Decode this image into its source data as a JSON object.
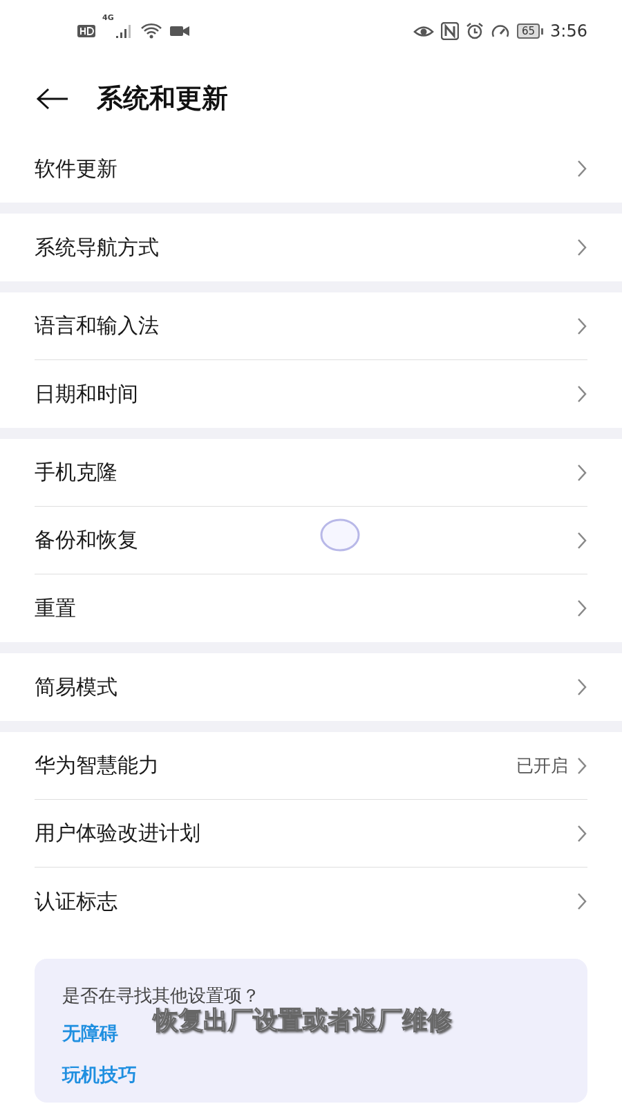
{
  "status_bar": {
    "network": "4G",
    "battery": "65",
    "time": "3:56"
  },
  "header": {
    "title": "系统和更新"
  },
  "groups": [
    {
      "rows": [
        {
          "label": "软件更新"
        }
      ]
    },
    {
      "rows": [
        {
          "label": "系统导航方式"
        }
      ]
    },
    {
      "rows": [
        {
          "label": "语言和输入法"
        },
        {
          "label": "日期和时间"
        }
      ]
    },
    {
      "rows": [
        {
          "label": "手机克隆"
        },
        {
          "label": "备份和恢复"
        },
        {
          "label": "重置"
        }
      ]
    },
    {
      "rows": [
        {
          "label": "简易模式"
        }
      ]
    },
    {
      "rows": [
        {
          "label": "华为智慧能力",
          "value": "已开启"
        },
        {
          "label": "用户体验改进计划"
        },
        {
          "label": "认证标志"
        }
      ]
    }
  ],
  "suggestions": {
    "title": "是否在寻找其他设置项？",
    "links": [
      "无障碍",
      "玩机技巧"
    ]
  },
  "caption": "恢复出厂设置或者返厂维修"
}
